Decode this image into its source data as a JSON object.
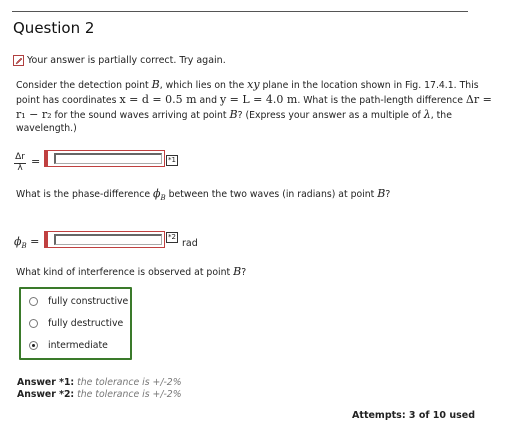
{
  "question": {
    "title": "Question 2"
  },
  "status": {
    "icon": "edit-icon",
    "text": "Your answer is partially correct.  Try again."
  },
  "body": {
    "p1": "Consider the detection point ",
    "pointB": "B",
    "p2": ", which lies on the ",
    "plane": "xy",
    "p3": " plane in the location shown in Fig. 17.4.1. This point has coordinates ",
    "coords": "x = d = 0.5 m",
    "p4": " and ",
    "coords2": "y = L = 4.0 m",
    "p5": ". What is the path-length difference ",
    "delta": "Δr = r₁ − r₂",
    "p6": " for the sound waves arriving at point ",
    "p7": "? (Express your answer as a multiple of ",
    "lambda": "λ",
    "p8": ", the wavelength.)"
  },
  "answer1": {
    "frac_num": "Δr",
    "frac_den": "λ",
    "equals": "=",
    "value": "",
    "tag": "*1"
  },
  "q2": {
    "text_a": "What is the phase-difference ",
    "phi": "ϕ",
    "sub": "B",
    "text_b": " between the two waves (in radians) at point ",
    "b": "B",
    "text_c": "?"
  },
  "answer2": {
    "label_phi": "ϕ",
    "label_sub": "B",
    "equals": "=",
    "value": "",
    "tag": "*2",
    "unit": "rad"
  },
  "q3": {
    "text_a": "What kind of interference is observed at point ",
    "b": "B",
    "text_c": "?"
  },
  "choices": [
    {
      "label": "fully constructive",
      "selected": false
    },
    {
      "label": "fully destructive",
      "selected": false
    },
    {
      "label": "intermediate",
      "selected": true
    }
  ],
  "answers": [
    {
      "label": "Answer ",
      "num": "*1:",
      "tol": " the tolerance is +/-2%"
    },
    {
      "label": "Answer ",
      "num": "*2:",
      "tol": " the tolerance is +/-2%"
    }
  ],
  "attempts": "Attempts: 3 of 10 used"
}
